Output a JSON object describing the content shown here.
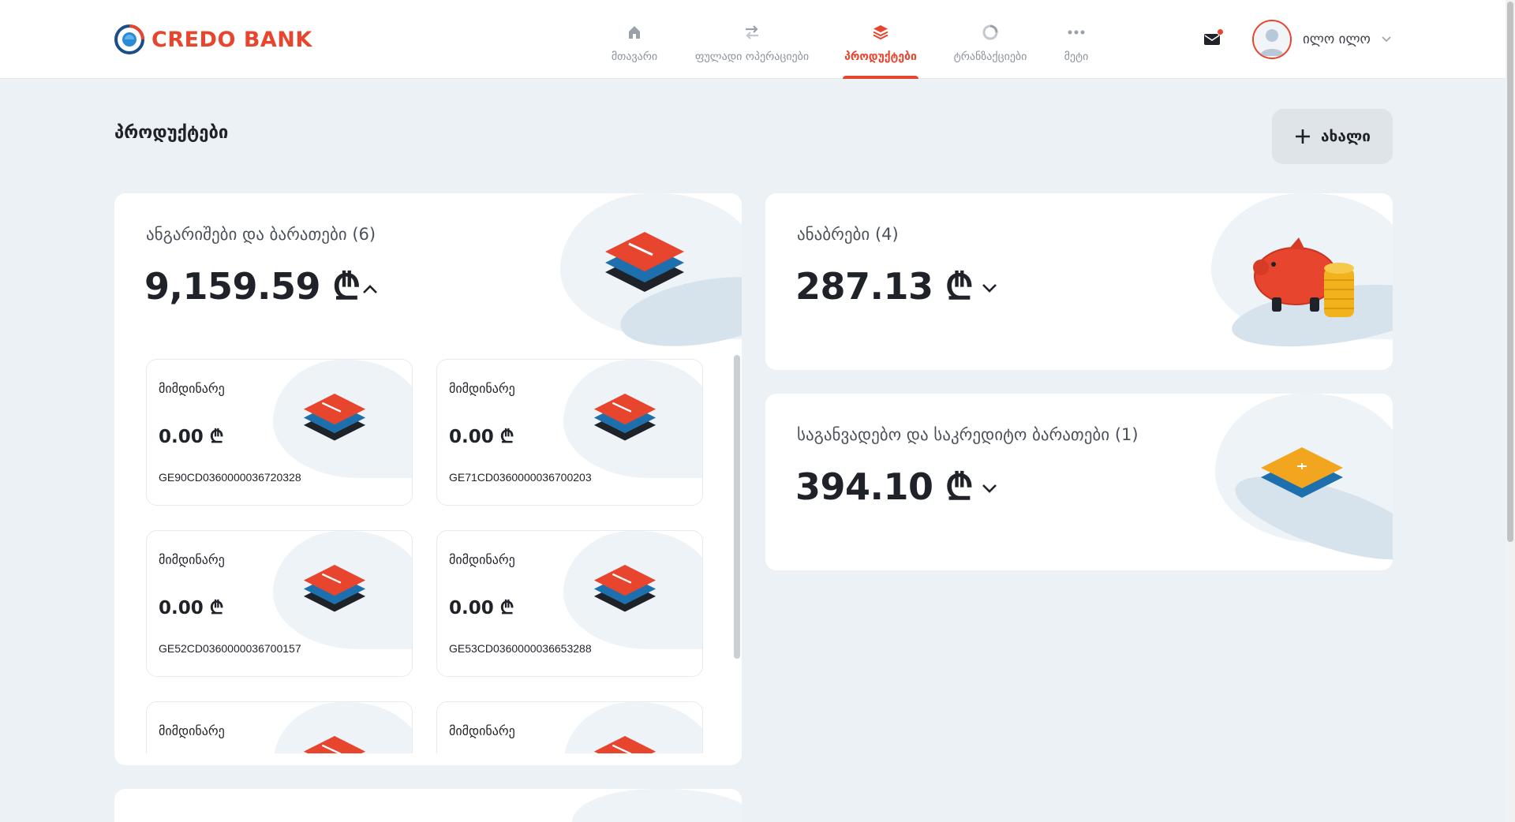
{
  "brand": {
    "name": "CREDO BANK",
    "accent": "#e8452f"
  },
  "nav": [
    {
      "label": "მთავარი",
      "icon": "home-icon"
    },
    {
      "label": "ფულადი ოპერაციები",
      "icon": "transfer-icon"
    },
    {
      "label": "პროდუქტები",
      "icon": "stack-icon",
      "active": true
    },
    {
      "label": "ტრანზაქციები",
      "icon": "history-icon"
    },
    {
      "label": "მეტი",
      "icon": "more-icon"
    }
  ],
  "user": {
    "name": "ილო ილო"
  },
  "page": {
    "title": "პროდუქტები",
    "new_button": "ახალი"
  },
  "accounts": {
    "title": "ანგარიშები და ბარათები (6)",
    "amount": "9,159.59 ₾",
    "items": [
      {
        "label": "მიმდინარე",
        "amount": "0.00 ₾",
        "iban": "GE90CD0360000036720328"
      },
      {
        "label": "მიმდინარე",
        "amount": "0.00 ₾",
        "iban": "GE71CD0360000036700203"
      },
      {
        "label": "მიმდინარე",
        "amount": "0.00 ₾",
        "iban": "GE52CD0360000036700157"
      },
      {
        "label": "მიმდინარე",
        "amount": "0.00 ₾",
        "iban": "GE53CD0360000036653288"
      },
      {
        "label": "მიმდინარე",
        "amount": "",
        "iban": ""
      },
      {
        "label": "მიმდინარე",
        "amount": "",
        "iban": ""
      }
    ]
  },
  "deposits": {
    "title": "ანაბრები (4)",
    "amount": "287.13 ₾"
  },
  "credit_cards": {
    "title": "საგანვადებო და საკრედიტო ბარათები (1)",
    "amount": "394.10 ₾"
  }
}
